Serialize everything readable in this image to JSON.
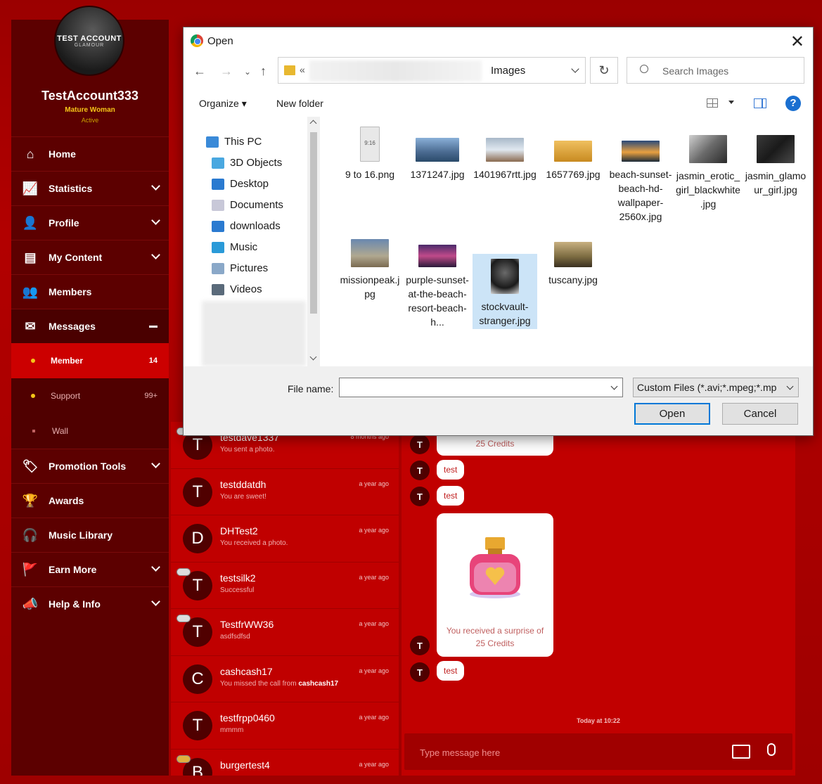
{
  "sidebar": {
    "avatar_text": "TEST ACCOUNT",
    "avatar_subtext": "GLAMOUR",
    "username": "TestAccount333",
    "role": "Mature Woman",
    "status": "Active",
    "items": [
      {
        "label": "Home"
      },
      {
        "label": "Statistics"
      },
      {
        "label": "Profile"
      },
      {
        "label": "My Content"
      },
      {
        "label": "Members"
      },
      {
        "label": "Messages"
      }
    ],
    "messages_sub": [
      {
        "label": "Member",
        "count": "14"
      },
      {
        "label": "Support",
        "count": "99+"
      },
      {
        "label": "Wall",
        "count": ""
      }
    ],
    "items_after": [
      {
        "label": "Promotion Tools"
      },
      {
        "label": "Awards"
      },
      {
        "label": "Music Library"
      },
      {
        "label": "Earn More"
      },
      {
        "label": "Help & Info"
      }
    ]
  },
  "conversations": [
    {
      "initial": "T",
      "name": "testdave1337",
      "preview": "You sent a photo.",
      "time": "8 months ago"
    },
    {
      "initial": "T",
      "name": "testddatdh",
      "preview": "You are sweet!",
      "time": "a year ago"
    },
    {
      "initial": "D",
      "name": "DHTest2",
      "preview": "You received a photo.",
      "time": "a year ago"
    },
    {
      "initial": "T",
      "name": "testsilk2",
      "preview": "Successful",
      "time": "a year ago"
    },
    {
      "initial": "T",
      "name": "TestfrWW36",
      "preview": "asdfsdfsd",
      "time": "a year ago"
    },
    {
      "initial": "C",
      "name": "cashcash17",
      "preview": "You missed the call from",
      "preview_bold": "cashcash17",
      "time": "a year ago"
    },
    {
      "initial": "T",
      "name": "testfrpp0460",
      "preview": "mmmm",
      "time": "a year ago"
    },
    {
      "initial": "B",
      "name": "burgertest4",
      "preview": "",
      "time": "a year ago"
    }
  ],
  "chat": {
    "avatar_initial": "T",
    "credits_top": "25 Credits",
    "msg1": "test",
    "msg2": "test",
    "surprise_text": "You received a surprise of",
    "surprise_credits": "25 Credits",
    "msg3": "test",
    "date_separator": "Today at 10:22",
    "composer_placeholder": "Type message here"
  },
  "dialog": {
    "title": "Open",
    "address_prefix": "«",
    "address_current": "Images",
    "search_placeholder": "Search Images",
    "organize_label": "Organize ▾",
    "new_folder_label": "New folder",
    "help_label": "?",
    "tree": [
      {
        "label": "This PC",
        "icon": "pc-icon",
        "color": "#3a8ad8"
      },
      {
        "label": "3D Objects",
        "icon": "cube-icon",
        "color": "#4aa8e0"
      },
      {
        "label": "Desktop",
        "icon": "desktop-icon",
        "color": "#2a7ad0"
      },
      {
        "label": "Documents",
        "icon": "document-icon",
        "color": "#c8c8d8"
      },
      {
        "label": "downloads",
        "icon": "download-icon",
        "color": "#2a7ad0"
      },
      {
        "label": "Music",
        "icon": "music-icon",
        "color": "#2a9ad8"
      },
      {
        "label": "Pictures",
        "icon": "pictures-icon",
        "color": "#8aa8c8"
      },
      {
        "label": "Videos",
        "icon": "videos-icon",
        "color": "#5a6a7a"
      }
    ],
    "files": [
      {
        "name": "9 to 16.png",
        "thumb": "#e8e8e8",
        "label_in_thumb": "9:16"
      },
      {
        "name": "1371247.jpg",
        "thumb": "#6a90b8"
      },
      {
        "name": "1401967rtt.jpg",
        "thumb": "#8aa0b0"
      },
      {
        "name": "1657769.jpg",
        "thumb": "#d8a040"
      },
      {
        "name": "beach-sunset-beach-hd-wallpaper-2560x.jpg",
        "thumb": "#4a6a90"
      },
      {
        "name": "jasmin_erotic_girl_blackwhite.jpg",
        "thumb": "#5a5a5a"
      },
      {
        "name": "jasmin_glamour_girl.jpg",
        "thumb": "#2a2a2a"
      },
      {
        "name": "missionpeak.jpg",
        "thumb": "#7a90a8"
      },
      {
        "name": "purple-sunset-at-the-beach-resort-beach-h...",
        "thumb": "#6a4a8a"
      },
      {
        "name": "stockvault-stranger.jpg",
        "thumb": "#3a3a3a",
        "selected": true
      },
      {
        "name": "tuscany.jpg",
        "thumb": "#7a6a40"
      }
    ],
    "file_name_label": "File name:",
    "file_name_value": "",
    "filter_value": "Custom Files (*.avi;*.mpeg;*.mp",
    "open_button": "Open",
    "cancel_button": "Cancel"
  }
}
